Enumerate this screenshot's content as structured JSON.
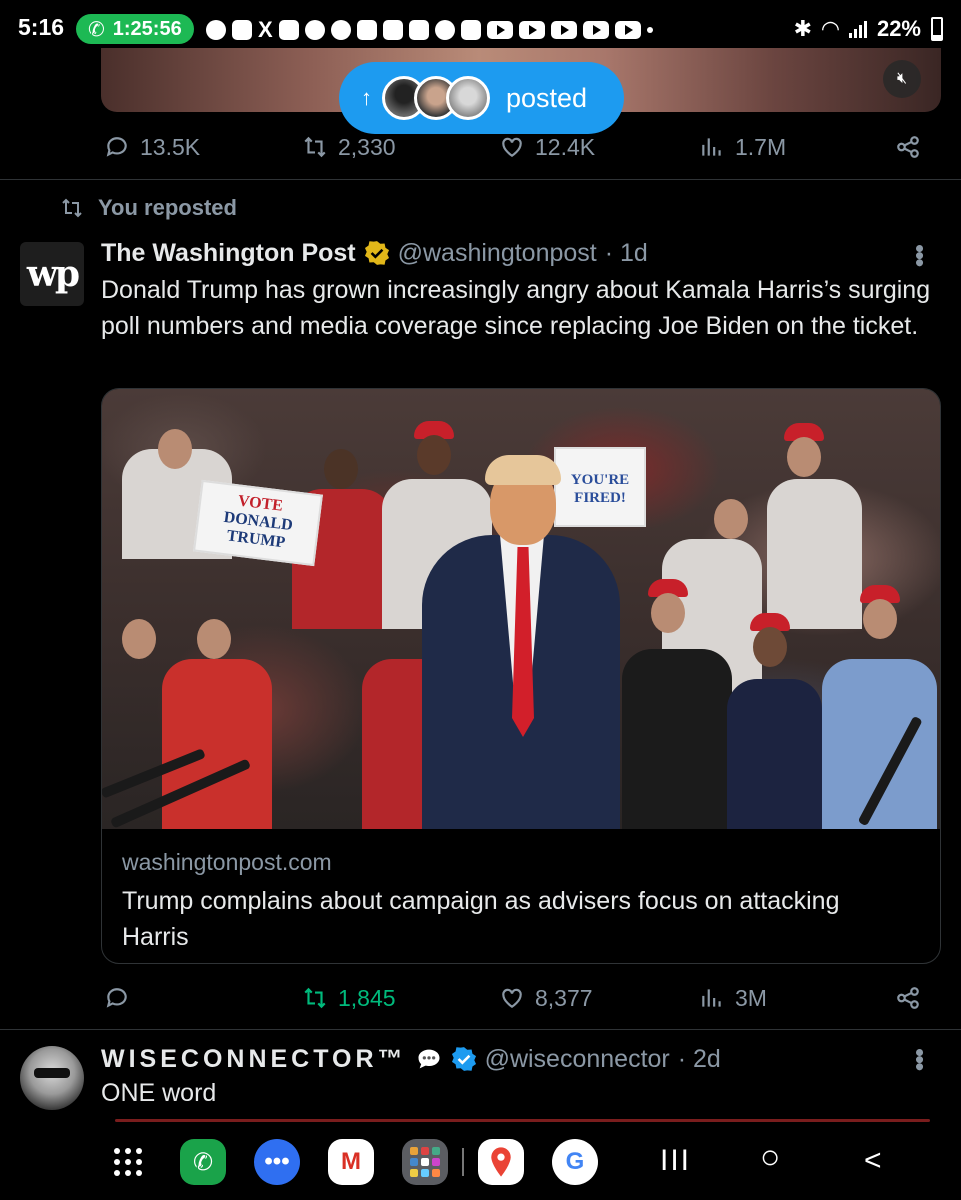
{
  "status_bar": {
    "time": "5:16",
    "call_duration": "1:25:56",
    "battery": "22%"
  },
  "top_tweet": {
    "posted_label": "posted",
    "posted_arrow": "↑",
    "replies": "13.5K",
    "reposts": "2,330",
    "likes": "12.4K",
    "views": "1.7M",
    "mute_icon": "speaker-muted-icon"
  },
  "repost_tweet": {
    "repost_label": "You reposted",
    "avatar_text": "wp",
    "author": "The Washington Post",
    "handle": "@washingtonpost",
    "time": "· 1d",
    "text": "Donald Trump has grown increasingly angry about Kamala Harris’s surging poll numbers and media coverage since replacing Joe Biden on the ticket.",
    "card": {
      "domain": "washingtonpost.com",
      "title": "Trump complains about campaign as advisers focus on attacking Harris",
      "sign_vote": [
        "VOTE",
        "DONALD",
        "TRUMP"
      ],
      "sign_fired": "YOU'RE FIRED!"
    },
    "replies": "",
    "reposts": "1,845",
    "likes": "8,377",
    "views": "3M",
    "verified_color": "#e2b719",
    "repost_active_color": "#00ba7c"
  },
  "next_tweet": {
    "author": "WISECONNECTOR™",
    "handle": "@wiseconnector",
    "time": "· 2d",
    "text": "ONE word",
    "verified_color": "#1d9bf0"
  },
  "nav_bar": {
    "apps": [
      "apps-icon",
      "phone-icon",
      "messages-icon",
      "gmail-icon",
      "app-folder-icon",
      "maps-icon",
      "google-icon"
    ],
    "gmail_glyph": "M",
    "google_glyph": "G",
    "recents_glyph": "III",
    "home_glyph": "○",
    "back_glyph": "<"
  },
  "colors": {
    "background": "#000000",
    "text_primary": "#e7e9ea",
    "text_secondary": "#8b98a5",
    "accent": "#1d9bf0"
  }
}
